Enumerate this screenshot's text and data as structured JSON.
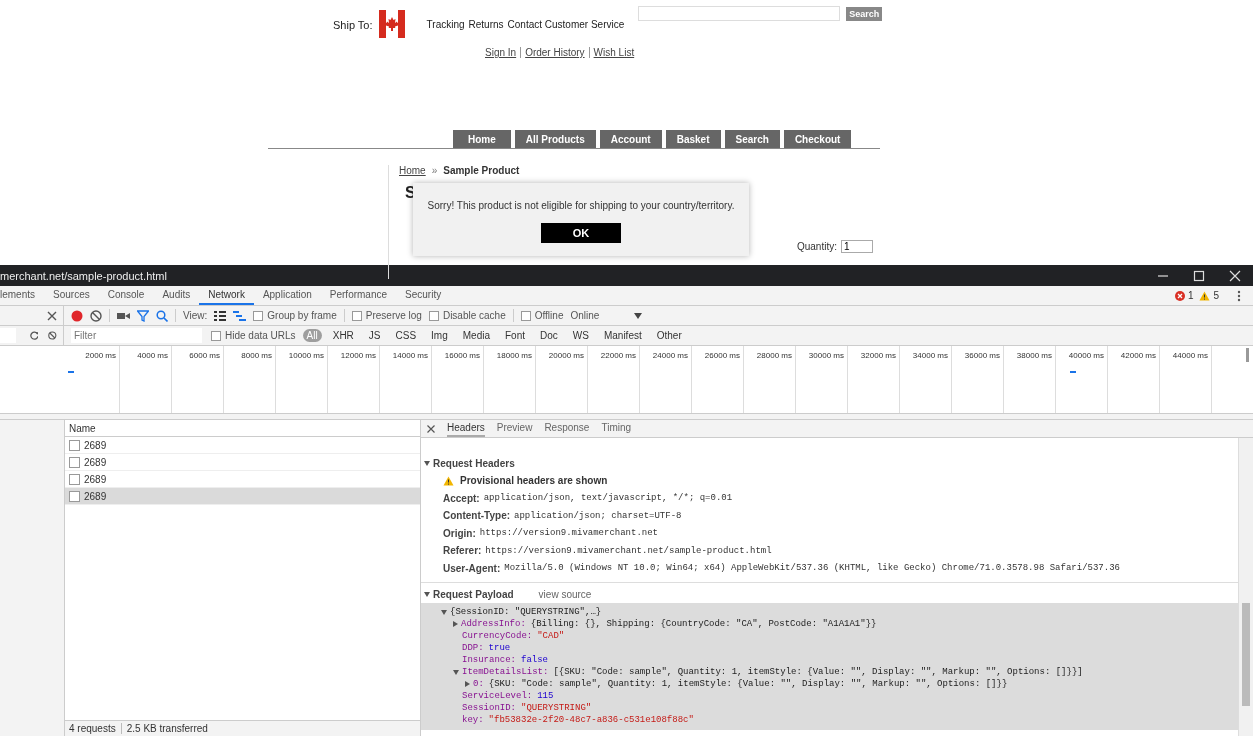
{
  "site": {
    "ship_to": "Ship To:",
    "top_links": [
      "Tracking",
      "Returns",
      "Contact Customer Service"
    ],
    "search_button": "Search",
    "account_links": [
      "Sign In",
      "Order History",
      "Wish List"
    ],
    "nav": [
      "Home",
      "All Products",
      "Account",
      "Basket",
      "Search",
      "Checkout"
    ],
    "breadcrumb": {
      "home": "Home",
      "separator": "»",
      "current": "Sample Product"
    },
    "heading": "S",
    "quantity": {
      "label": "Quantity:",
      "value": "1"
    },
    "dialog": {
      "message": "Sorry! This product is not eligible for shipping to your country/territory.",
      "button": "OK"
    }
  },
  "devtools": {
    "window_title": "merchant.net/sample-product.html",
    "tabs": [
      {
        "label": "lements",
        "selected": false
      },
      {
        "label": "Sources",
        "selected": false
      },
      {
        "label": "Console",
        "selected": false
      },
      {
        "label": "Audits",
        "selected": false
      },
      {
        "label": "Network",
        "selected": true
      },
      {
        "label": "Application",
        "selected": false
      },
      {
        "label": "Performance",
        "selected": false
      },
      {
        "label": "Security",
        "selected": false
      }
    ],
    "errors": "1",
    "warnings": "5",
    "toolbar": {
      "recording": true,
      "view_label": "View:",
      "options": [
        {
          "label": "Group by frame",
          "checked": false
        },
        {
          "label": "Preserve log",
          "checked": false
        },
        {
          "label": "Disable cache",
          "checked": false
        },
        {
          "label": "Offline",
          "checked": false
        }
      ],
      "throttle": "Online"
    },
    "filter": {
      "placeholder": "Filter",
      "hide_data_urls": {
        "label": "Hide data URLs",
        "checked": false
      },
      "types": [
        {
          "label": "All",
          "selected": true
        },
        {
          "label": "XHR",
          "selected": false
        },
        {
          "label": "JS",
          "selected": false
        },
        {
          "label": "CSS",
          "selected": false
        },
        {
          "label": "Img",
          "selected": false
        },
        {
          "label": "Media",
          "selected": false
        },
        {
          "label": "Font",
          "selected": false
        },
        {
          "label": "Doc",
          "selected": false
        },
        {
          "label": "WS",
          "selected": false
        },
        {
          "label": "Manifest",
          "selected": false
        },
        {
          "label": "Other",
          "selected": false
        }
      ]
    },
    "timeline_ticks": [
      "2000 ms",
      "4000 ms",
      "6000 ms",
      "8000 ms",
      "10000 ms",
      "12000 ms",
      "14000 ms",
      "16000 ms",
      "18000 ms",
      "20000 ms",
      "22000 ms",
      "24000 ms",
      "26000 ms",
      "28000 ms",
      "30000 ms",
      "32000 ms",
      "34000 ms",
      "36000 ms",
      "38000 ms",
      "40000 ms",
      "42000 ms",
      "44000 ms"
    ],
    "requests": {
      "column": "Name",
      "rows": [
        {
          "name": "2689",
          "selected": false
        },
        {
          "name": "2689",
          "selected": false
        },
        {
          "name": "2689",
          "selected": false
        },
        {
          "name": "2689",
          "selected": true
        }
      ]
    },
    "status": [
      "4 requests",
      "2.5 KB transferred"
    ],
    "detail_tabs": [
      {
        "label": "Headers",
        "selected": true
      },
      {
        "label": "Preview",
        "selected": false
      },
      {
        "label": "Response",
        "selected": false
      },
      {
        "label": "Timing",
        "selected": false
      }
    ],
    "request_headers": {
      "title": "Request Headers",
      "expanded": true,
      "notice": "Provisional headers are shown",
      "headers": [
        {
          "name": "Accept:",
          "value": "application/json, text/javascript, */*; q=0.01"
        },
        {
          "name": "Content-Type:",
          "value": "application/json; charset=UTF-8"
        },
        {
          "name": "Origin:",
          "value": "https://version9.mivamerchant.net"
        },
        {
          "name": "Referer:",
          "value": "https://version9.mivamerchant.net/sample-product.html"
        },
        {
          "name": "User-Agent:",
          "value": "Mozilla/5.0 (Windows NT 10.0; Win64; x64) AppleWebKit/537.36 (KHTML, like Gecko) Chrome/71.0.3578.98 Safari/537.36"
        }
      ]
    },
    "payload": {
      "title": "Request Payload",
      "expanded": true,
      "view_source": "view source",
      "tree": [
        {
          "value": "{SessionID: \"QUERYSTRING\",…}",
          "kind": "object",
          "expanded": true,
          "children": [
            {
              "key": "AddressInfo:",
              "value": "{Billing: {}, Shipping: {CountryCode: \"CA\", PostCode: \"A1A1A1\"}}",
              "kind": "object",
              "expanded": false
            },
            {
              "key": "CurrencyCode:",
              "value": "\"CAD\"",
              "kind": "string"
            },
            {
              "key": "DDP:",
              "value": "true",
              "kind": "literal"
            },
            {
              "key": "Insurance:",
              "value": "false",
              "kind": "literal"
            },
            {
              "key": "ItemDetailsList:",
              "value": "[{SKU: \"Code: sample\", Quantity: 1, itemStyle: {Value: \"\", Display: \"\", Markup: \"\", Options: []}}]",
              "kind": "object",
              "expanded": true,
              "children": [
                {
                  "key": "0:",
                  "value": "{SKU: \"Code: sample\", Quantity: 1, itemStyle: {Value: \"\", Display: \"\", Markup: \"\", Options: []}}",
                  "kind": "object",
                  "expanded": false
                }
              ]
            },
            {
              "key": "ServiceLevel:",
              "value": "115",
              "kind": "literal"
            },
            {
              "key": "SessionID:",
              "value": "\"QUERYSTRING\"",
              "kind": "string"
            },
            {
              "key": "key:",
              "value": "\"fb53832e-2f20-48c7-a836-c531e108f88c\"",
              "kind": "string"
            }
          ]
        }
      ]
    }
  }
}
